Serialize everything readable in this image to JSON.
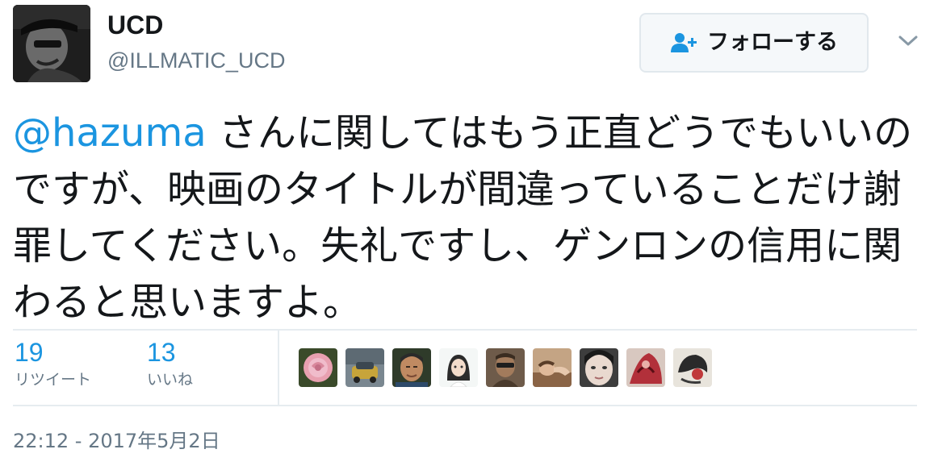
{
  "user": {
    "display_name": "UCD",
    "handle": "@ILLMATIC_UCD",
    "avatar_icon": "user-avatar"
  },
  "follow_button": {
    "label": "フォローする",
    "icon": "add-user-icon"
  },
  "tweet": {
    "mention": "@hazuma",
    "text": " さんに関してはもう正直どうでもいいのですが、映画のタイトルが間違っていることだけ謝罪してください。失礼ですし、ゲンロンの信用に関わると思いますよ。"
  },
  "stats": {
    "retweets": {
      "count": "19",
      "label": "リツイート"
    },
    "likes": {
      "count": "13",
      "label": "いいね"
    }
  },
  "liked_by": [
    {
      "icon": "rose-photo-avatar"
    },
    {
      "icon": "car-photo-avatar"
    },
    {
      "icon": "man-portrait-avatar"
    },
    {
      "icon": "girl-illustration-avatar"
    },
    {
      "icon": "man-sunglasses-avatar"
    },
    {
      "icon": "person-lying-avatar"
    },
    {
      "icon": "face-closeup-avatar"
    },
    {
      "icon": "red-artwork-avatar"
    },
    {
      "icon": "dark-artwork-avatar"
    }
  ],
  "timestamp": "22:12 - 2017年5月2日",
  "colors": {
    "link": "#1b95e0",
    "secondary_text": "#657786",
    "text": "#14171a",
    "border": "#e6ecf0",
    "button_bg": "#f5f8fa"
  }
}
